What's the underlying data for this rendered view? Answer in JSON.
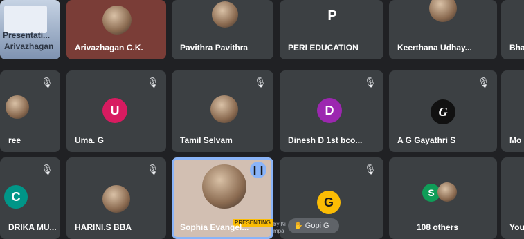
{
  "participants": {
    "row1": [
      {
        "label": "Presentati...",
        "shared_by": "Arivazhagan"
      },
      {
        "name": "Arivazhagan C.K."
      },
      {
        "name": "Pavithra Pavithra"
      },
      {
        "name": "PERI EDUCATION",
        "avatar_letter": "P"
      },
      {
        "name": "Keerthana Udhay..."
      },
      {
        "name": "Bha"
      }
    ],
    "row2": [
      {
        "name": "ree"
      },
      {
        "name": "Uma. G",
        "avatar_letter": "U",
        "color": "#d81b60"
      },
      {
        "name": "Tamil Selvam"
      },
      {
        "name": "Dinesh D 1st bco...",
        "avatar_letter": "D",
        "color": "#9c27b0"
      },
      {
        "name": "A G Gayathri S",
        "avatar_letter": "G"
      },
      {
        "name": "Mo"
      }
    ],
    "row3": [
      {
        "name": "DRIKA MU...",
        "avatar_letter": "C",
        "color": "#009688"
      },
      {
        "name": "HARINI.S BBA"
      },
      {
        "name": "Sophia Evangel...",
        "badge": "PRESENTING"
      },
      {
        "name": "",
        "avatar_letter": "G",
        "color": "#fbbc04"
      },
      {
        "name": "108 others",
        "chip": "S"
      },
      {
        "name": "You"
      }
    ]
  },
  "pill": {
    "label": "Gopi G"
  },
  "watermark": {
    "line1": "by Ki",
    "line2": "mpa"
  },
  "icons": {
    "mic_off": "mic-off-icon",
    "hand": "hand-icon",
    "talking": "talking-icon"
  }
}
